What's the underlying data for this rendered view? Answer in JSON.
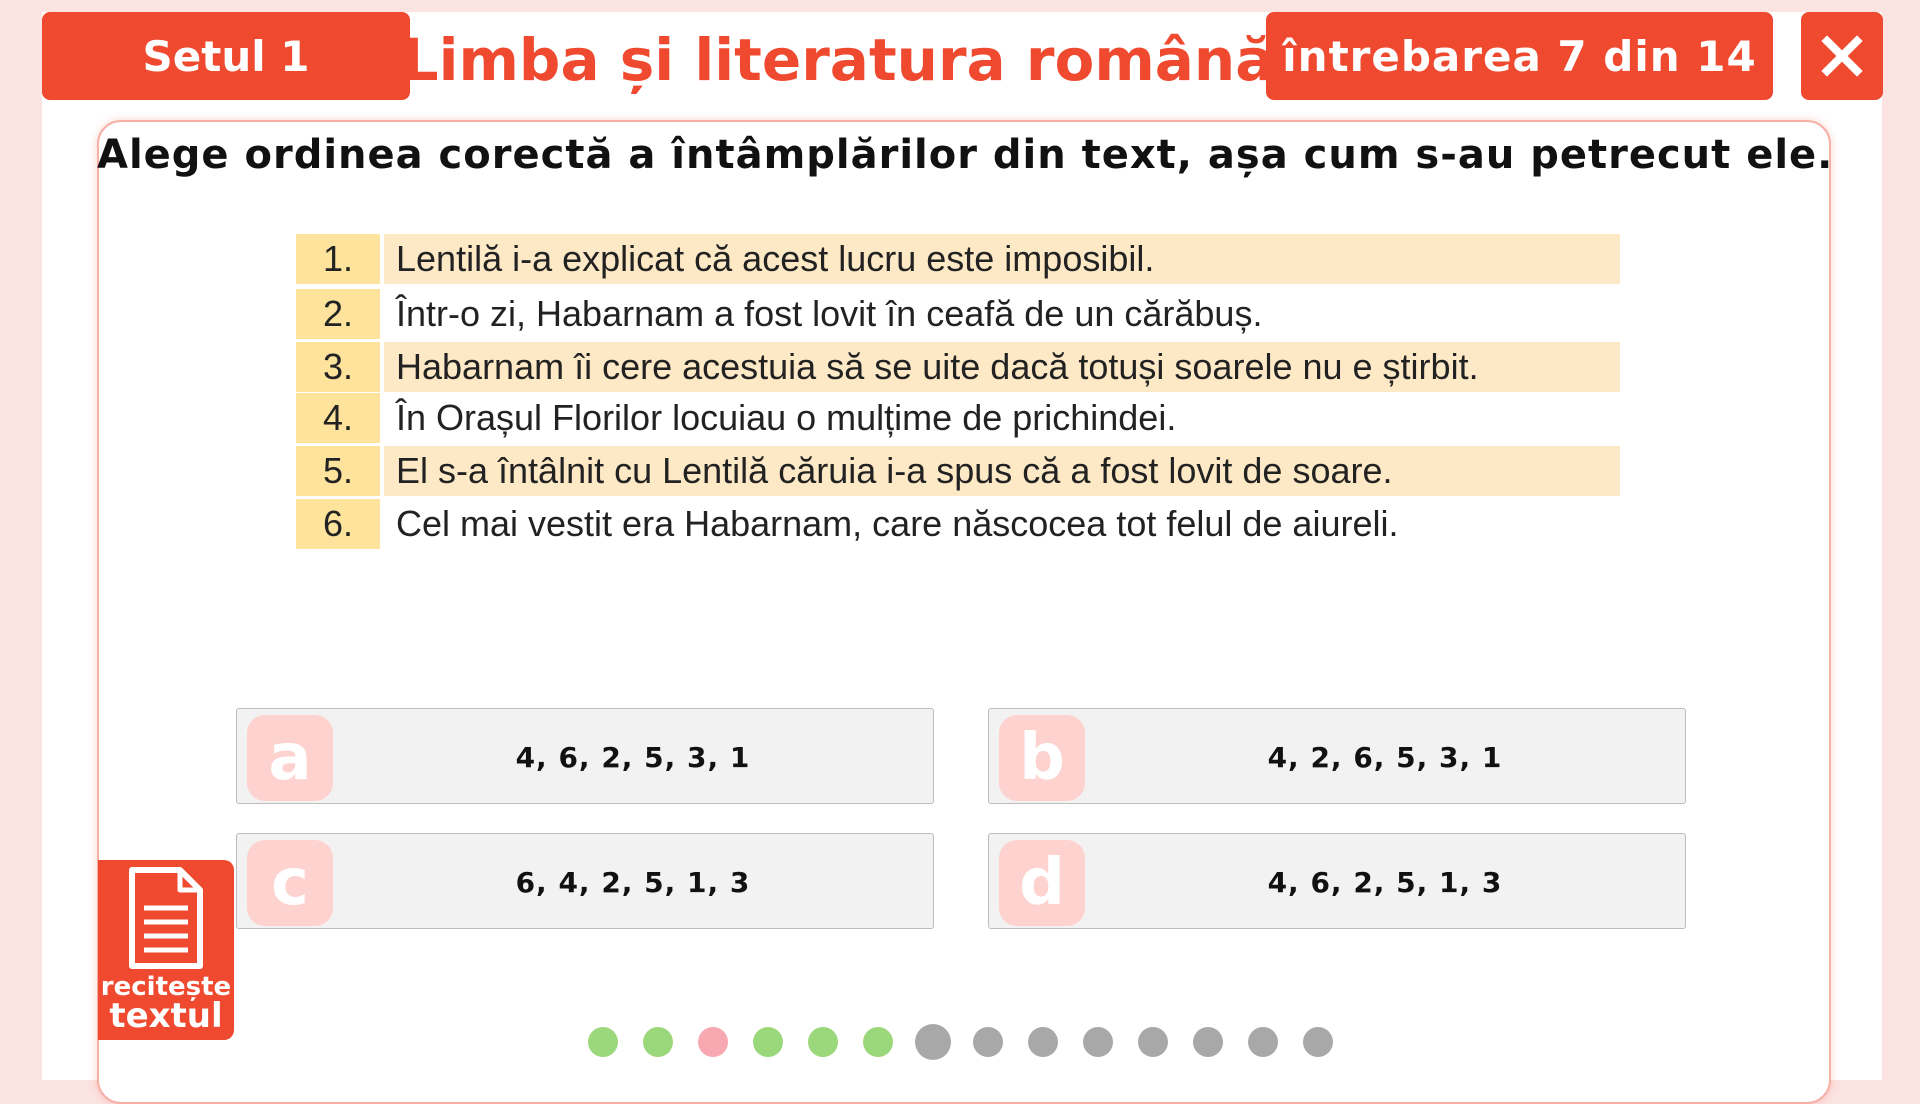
{
  "header": {
    "set_label": "Setul 1",
    "title": "Limba și literatura română",
    "question_counter": "întrebarea 7 din 14",
    "close_icon": "close-icon"
  },
  "question": {
    "prompt": "Alege ordinea corectă a întâmplărilor din text, așa cum s-au petrecut ele."
  },
  "events": [
    {
      "num": "1.",
      "text": "Lentilă i-a explicat că acest lucru este imposibil.",
      "highlight": true
    },
    {
      "num": "2.",
      "text": "Într-o zi, Habarnam a fost lovit în ceafă de un cărăbuș.",
      "highlight": false
    },
    {
      "num": "3.",
      "text": "Habarnam îi cere acestuia să se uite dacă totuși soarele nu e știrbit.",
      "highlight": true
    },
    {
      "num": "4.",
      "text": "În Orașul Florilor locuiau o mulțime de prichindei.",
      "highlight": false
    },
    {
      "num": "5.",
      "text": "El s-a întâlnit cu Lentilă căruia i-a spus că a fost lovit de soare.",
      "highlight": true
    },
    {
      "num": "6.",
      "text": "Cel mai vestit era Habarnam, care născocea tot felul de aiureli.",
      "highlight": false
    }
  ],
  "answers": [
    {
      "letter": "a",
      "value": "4, 6, 2, 5, 3, 1"
    },
    {
      "letter": "b",
      "value": "4, 2, 6, 5, 3, 1"
    },
    {
      "letter": "c",
      "value": "6, 4, 2, 5, 1, 3"
    },
    {
      "letter": "d",
      "value": "4, 6, 2, 5, 1, 3"
    }
  ],
  "reread": {
    "line1": "recitește",
    "line2": "textul",
    "icon": "document-icon"
  },
  "progress": {
    "current": 7,
    "total": 14,
    "statuses": [
      "correct",
      "correct",
      "wrong",
      "correct",
      "correct",
      "correct",
      "current",
      "pending",
      "pending",
      "pending",
      "pending",
      "pending",
      "pending",
      "pending"
    ]
  },
  "colors": {
    "accent": "#ef4a2f",
    "number_bg": "#fde39b",
    "row_highlight": "#fde9c6",
    "correct": "#9bd77b",
    "wrong": "#f8a8b0",
    "pending": "#a8a8a8",
    "current": "#a8a8a8"
  }
}
